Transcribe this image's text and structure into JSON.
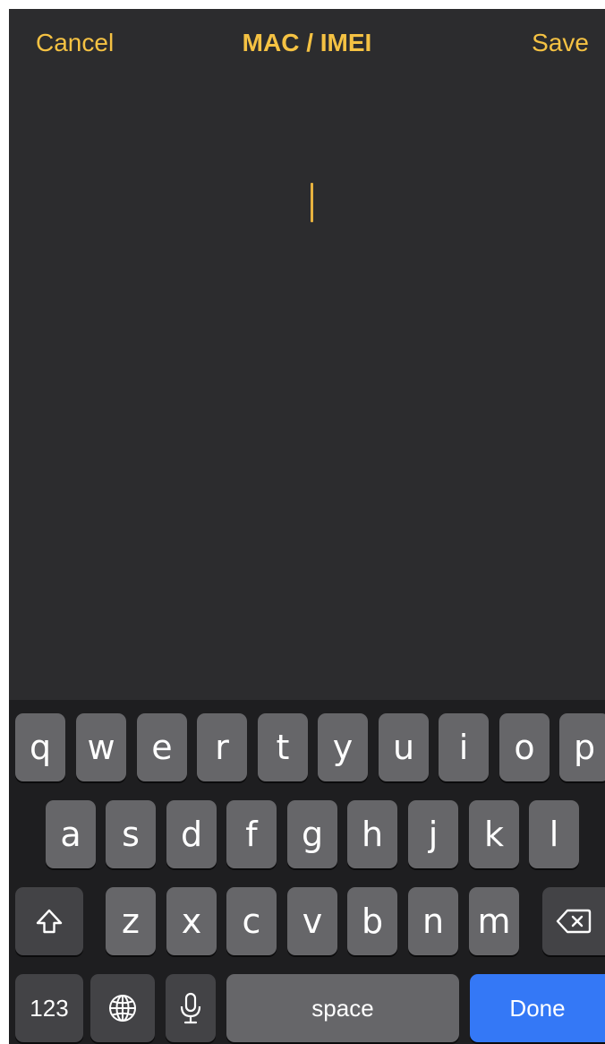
{
  "nav": {
    "cancel_label": "Cancel",
    "title": "MAC / IMEI",
    "save_label": "Save"
  },
  "colors": {
    "accent": "#f5c243",
    "background": "#2c2c2e",
    "keyboard_bg": "#1e1e20",
    "key_light": "#666669",
    "key_dark": "#434346",
    "done_blue": "#3478f6"
  },
  "keyboard": {
    "row1": [
      "q",
      "w",
      "e",
      "r",
      "t",
      "y",
      "u",
      "i",
      "o",
      "p"
    ],
    "row2": [
      "a",
      "s",
      "d",
      "f",
      "g",
      "h",
      "j",
      "k",
      "l"
    ],
    "row3": [
      "z",
      "x",
      "c",
      "v",
      "b",
      "n",
      "m"
    ],
    "numbers_label": "123",
    "space_label": "space",
    "done_label": "Done",
    "icons": {
      "shift": "shift-icon",
      "delete": "delete-icon",
      "globe": "globe-icon",
      "mic": "microphone-icon"
    }
  }
}
